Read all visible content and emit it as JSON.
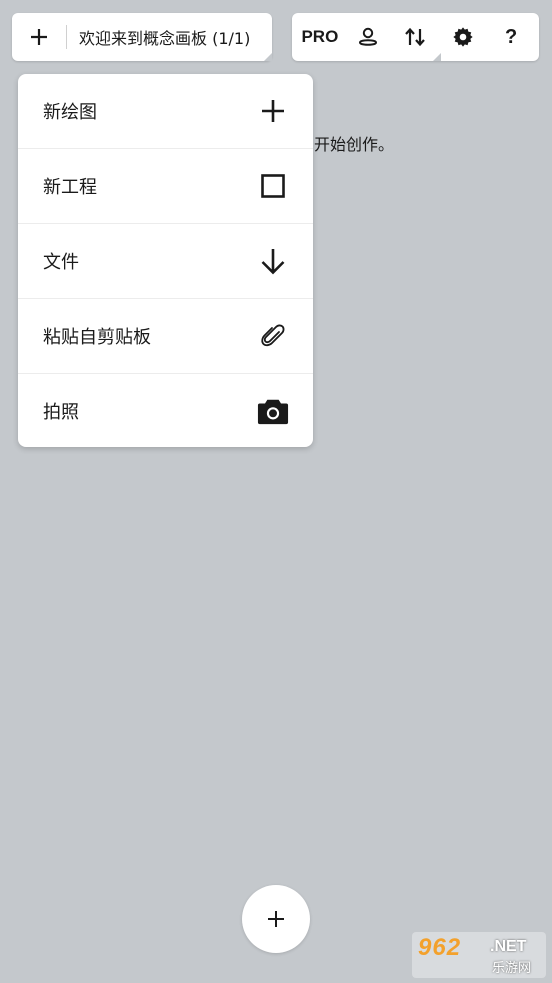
{
  "header": {
    "title": "欢迎来到概念画板 (1/1)",
    "new_icon": "plus-icon"
  },
  "toolbar": {
    "pro_label": "PRO",
    "account_icon": "user-icon",
    "sync_icon": "sort-arrows-icon",
    "settings_icon": "gear-icon",
    "help_label": "?"
  },
  "background_text": "开始创作。",
  "menu": {
    "items": [
      {
        "label": "新绘图",
        "icon": "plus-icon"
      },
      {
        "label": "新工程",
        "icon": "square-icon"
      },
      {
        "label": "文件",
        "icon": "arrow-down-icon"
      },
      {
        "label": "粘贴自剪贴板",
        "icon": "paperclip-icon"
      },
      {
        "label": "拍照",
        "icon": "camera-icon"
      }
    ]
  },
  "fab": {
    "icon": "plus-icon"
  },
  "watermark": {
    "brand": "962",
    "domain": ".NET",
    "subtitle": "乐游网"
  },
  "colors": {
    "background": "#c4c8cc",
    "surface": "#ffffff",
    "text": "#1a1a1a",
    "watermark_accent": "#f3a12c"
  }
}
